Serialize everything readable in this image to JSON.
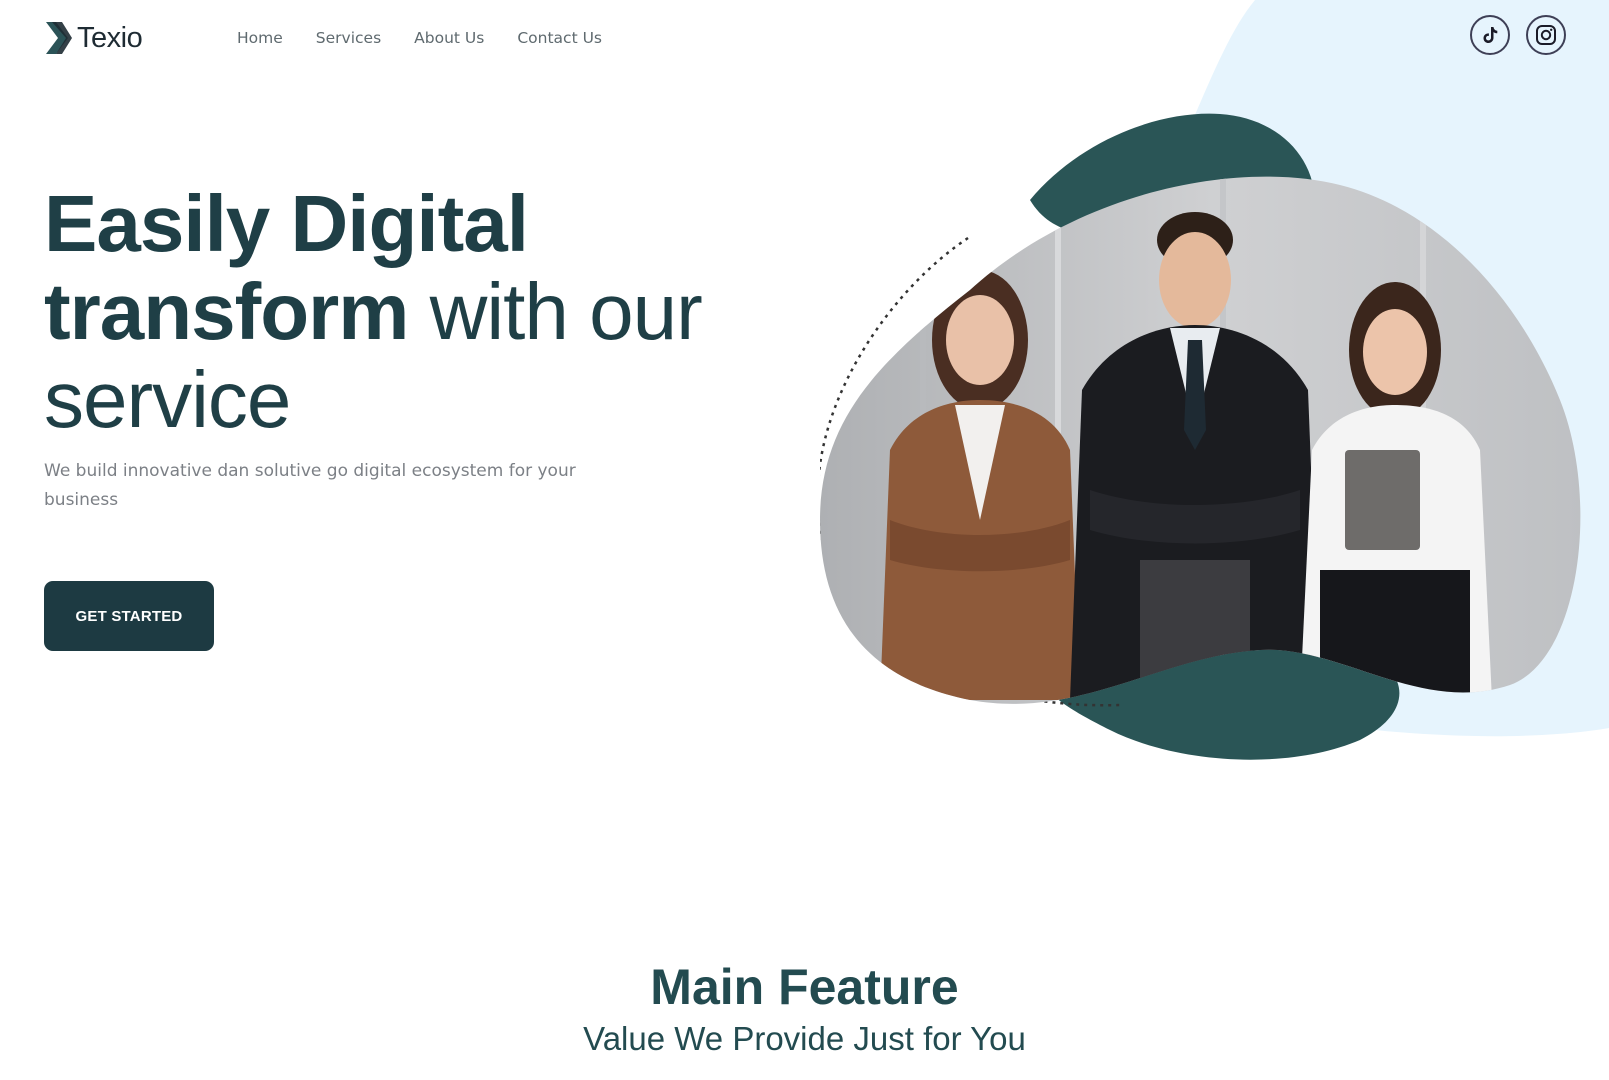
{
  "brand": {
    "name": "Texio",
    "logo_icon": "chevron-logo-icon"
  },
  "nav": {
    "items": [
      {
        "label": "Home"
      },
      {
        "label": "Services"
      },
      {
        "label": "About Us"
      },
      {
        "label": "Contact Us"
      }
    ]
  },
  "social": {
    "tiktok_icon": "tiktok-icon",
    "instagram_icon": "instagram-icon"
  },
  "hero": {
    "title_line1": "Easily Digital",
    "title_line2_strong": "transform",
    "title_line2_rest": " with our",
    "title_line3": "service",
    "subtitle": "We build innovative dan solutive go digital ecosystem for your business",
    "cta_label": "GET STARTED",
    "image_subject": "three business professionals in office attire"
  },
  "feature_section": {
    "title": "Main Feature",
    "subtitle": "Value We Provide Just for You"
  },
  "colors": {
    "primary": "#1d3a42",
    "accent_teal": "#2a5556",
    "light_blue": "#e6f4fd",
    "body_text": "#7c8086",
    "nav_text": "#5f6a6f"
  }
}
